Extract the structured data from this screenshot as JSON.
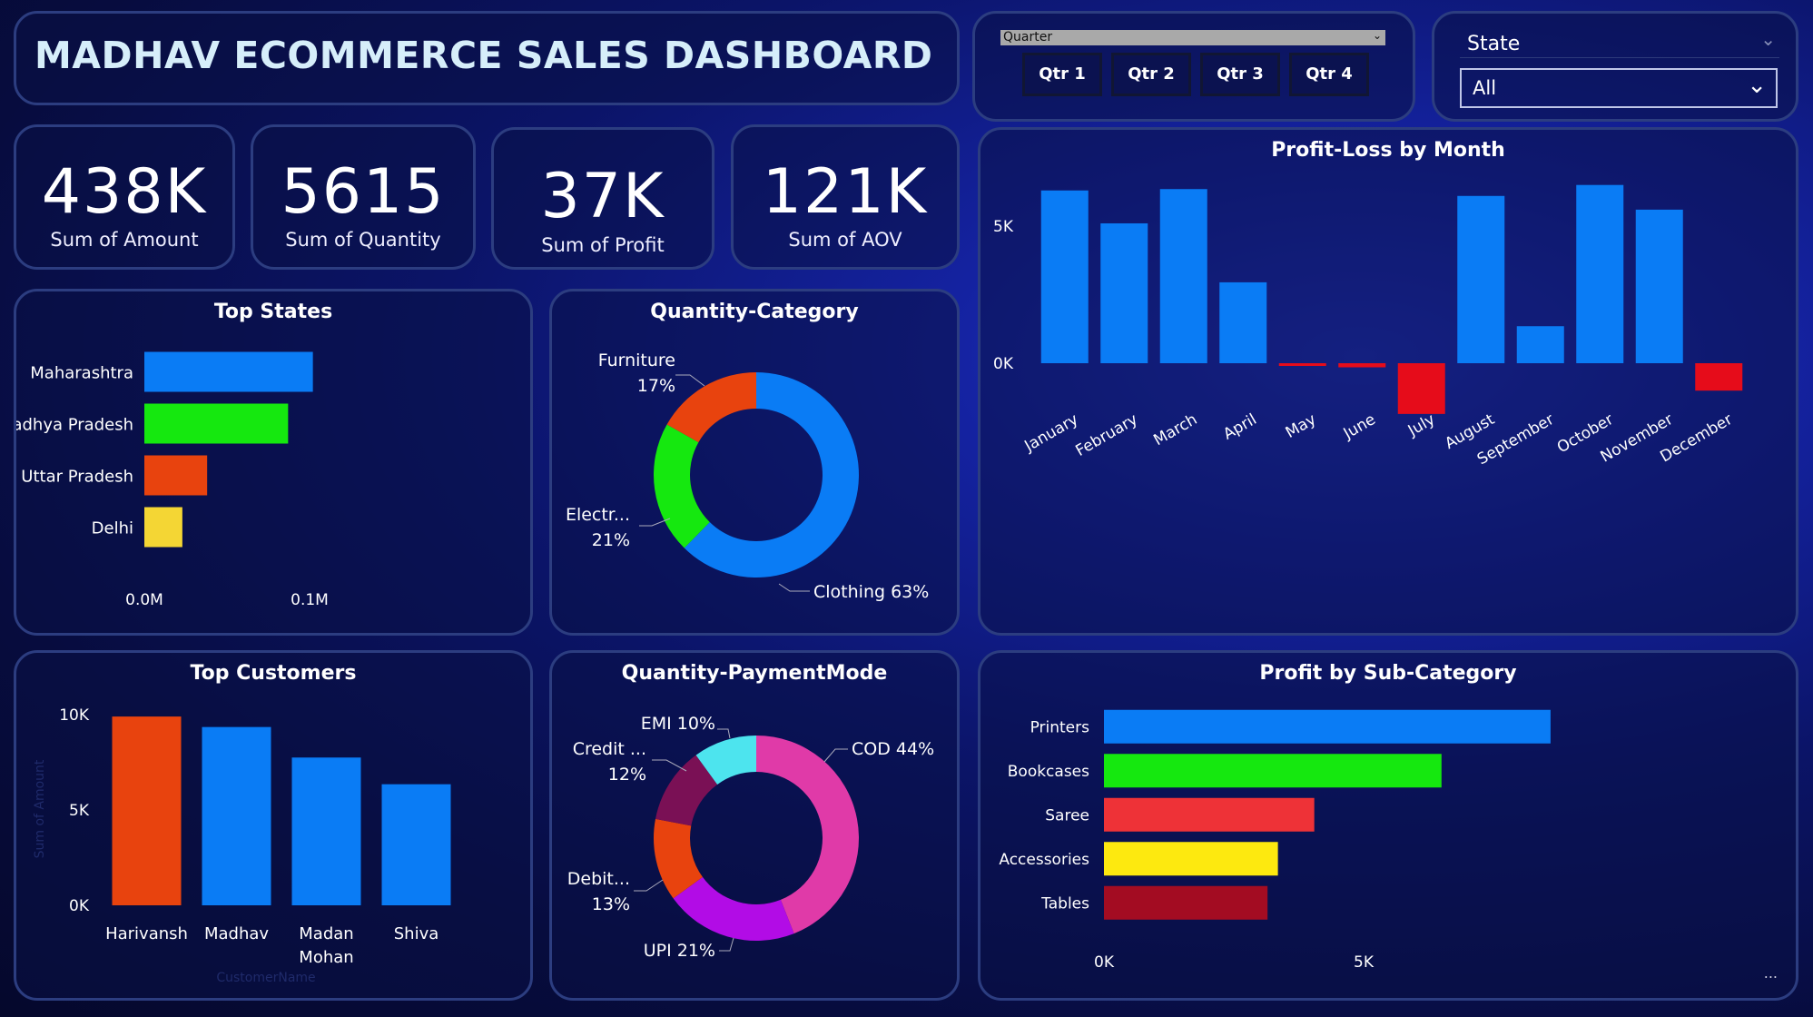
{
  "title": "MADHAV ECOMMERCE SALES DASHBOARD",
  "quarter_slicer": {
    "header": "Quarter",
    "buttons": [
      "Qtr 1",
      "Qtr 2",
      "Qtr 3",
      "Qtr 4"
    ]
  },
  "state_slicer": {
    "label": "State",
    "value": "All"
  },
  "kpis": [
    {
      "value": "438K",
      "label": "Sum of Amount"
    },
    {
      "value": "5615",
      "label": "Sum of Quantity"
    },
    {
      "value": "37K",
      "label": "Sum of Profit"
    },
    {
      "value": "121K",
      "label": "Sum of AOV"
    }
  ],
  "colors": {
    "blue": "#0a7cf5",
    "green": "#15e80f",
    "orange": "#e8430e",
    "yellow": "#f4d634",
    "red": "#e60c1a"
  },
  "more_options": "...",
  "chart_data": [
    {
      "id": "top_states",
      "type": "bar",
      "orientation": "horizontal",
      "title": "Top States",
      "categories": [
        "Maharashtra",
        "Madhya Pradesh",
        "Uttar Pradesh",
        "Delhi"
      ],
      "values": [
        102000,
        87000,
        38000,
        23000
      ],
      "colors": [
        "#0a7cf5",
        "#15e80f",
        "#e8430e",
        "#f4d634"
      ],
      "xlim": [
        0,
        100000
      ],
      "xticks": [
        "0.0M",
        "0.1M"
      ]
    },
    {
      "id": "quantity_category",
      "type": "pie",
      "donut": true,
      "title": "Quantity-Category",
      "slices": [
        {
          "name": "Clothing",
          "value": 63,
          "color": "#0a7cf5",
          "label": "Clothing 63%"
        },
        {
          "name": "Electronics",
          "value": 21,
          "color": "#15e80f",
          "label": "Electr...",
          "pct": "21%"
        },
        {
          "name": "Furniture",
          "value": 17,
          "color": "#e8430e",
          "label": "Furniture",
          "pct": "17%"
        }
      ]
    },
    {
      "id": "profit_loss_month",
      "type": "bar",
      "title": "Profit-Loss by Month",
      "categories": [
        "January",
        "February",
        "March",
        "April",
        "May",
        "June",
        "July",
        "August",
        "September",
        "October",
        "November",
        "December"
      ],
      "values": [
        6300,
        5100,
        6350,
        2950,
        -100,
        -150,
        -1850,
        6100,
        1350,
        6500,
        5600,
        -1000
      ],
      "colors": {
        "positive": "#0a7cf5",
        "negative": "#e60c1a"
      },
      "ylim": [
        -2000,
        8200
      ],
      "yticks": [
        {
          "v": 0,
          "label": "0K"
        },
        {
          "v": 5000,
          "label": "5K"
        }
      ]
    },
    {
      "id": "top_customers",
      "type": "bar",
      "title": "Top Customers",
      "categories": [
        "Harivansh",
        "Madhav",
        "Madan Mohan",
        "Shiva"
      ],
      "category_lines": [
        [
          "Harivansh"
        ],
        [
          "Madhav"
        ],
        [
          "Madan",
          "Mohan"
        ],
        [
          "Shiva"
        ]
      ],
      "values": [
        9900,
        9350,
        7750,
        6350
      ],
      "colors": [
        "#e8430e",
        "#0a7cf5",
        "#0a7cf5",
        "#0a7cf5"
      ],
      "ylim": [
        0,
        10000
      ],
      "yticks": [
        {
          "v": 0,
          "label": "0K"
        },
        {
          "v": 5000,
          "label": "5K"
        },
        {
          "v": 10000,
          "label": "10K"
        }
      ],
      "xlabel": "CustomerName",
      "ylabel": "Sum of Amount"
    },
    {
      "id": "quantity_paymentmode",
      "type": "pie",
      "donut": true,
      "title": "Quantity-PaymentMode",
      "slices": [
        {
          "name": "COD",
          "value": 44,
          "color": "#e03aa8",
          "label": "COD 44%"
        },
        {
          "name": "UPI",
          "value": 21,
          "color": "#b20ce6",
          "label": "UPI 21%"
        },
        {
          "name": "Debit Card",
          "value": 13,
          "color": "#e8430e",
          "label": "Debit...",
          "pct": "13%"
        },
        {
          "name": "Credit Card",
          "value": 12,
          "color": "#7a1055",
          "label": "Credit ...",
          "pct": "12%"
        },
        {
          "name": "EMI",
          "value": 10,
          "color": "#4de4ee",
          "label": "EMI 10%"
        }
      ]
    },
    {
      "id": "profit_subcategory",
      "type": "bar",
      "orientation": "horizontal",
      "title": "Profit by Sub-Category",
      "categories": [
        "Printers",
        "Bookcases",
        "Saree",
        "Accessories",
        "Tables"
      ],
      "values": [
        8600,
        6500,
        4050,
        3350,
        3150
      ],
      "colors": [
        "#0a7cf5",
        "#15e80f",
        "#ee3237",
        "#fde90f",
        "#a30c22"
      ],
      "xlim": [
        0,
        5000
      ],
      "xticks": [
        {
          "v": 0,
          "label": "0K"
        },
        {
          "v": 5000,
          "label": "5K"
        }
      ]
    }
  ]
}
